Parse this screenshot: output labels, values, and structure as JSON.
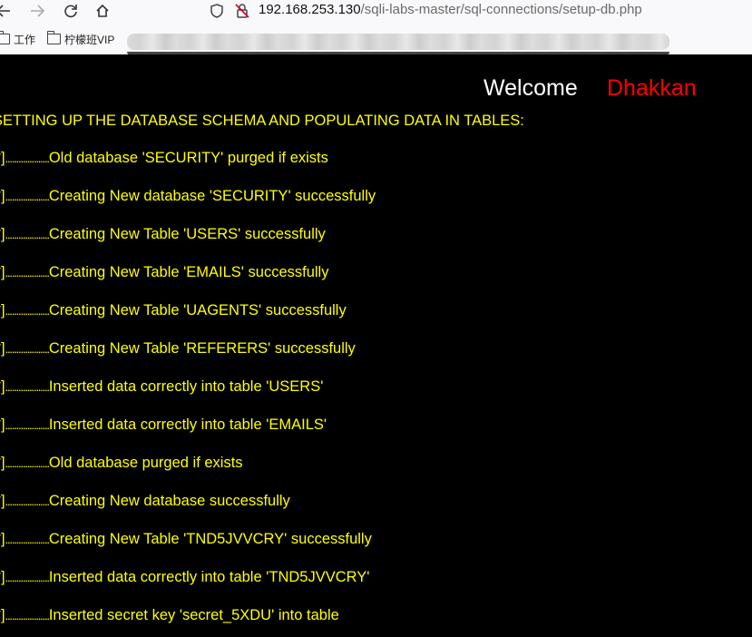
{
  "browser": {
    "back_icon": "arrow-left-icon",
    "forward_icon": "arrow-right-icon",
    "reload_icon": "reload-icon",
    "home_icon": "home-icon",
    "tracking_icon": "shield-icon",
    "insecure_icon": "lock-slash-icon",
    "url_host": "192.168.253.130",
    "url_path": "/sqli-labs-master/sql-connections/setup-db.php"
  },
  "bookmarks": [
    {
      "label": "工作",
      "icon": "folder-icon"
    },
    {
      "label": "柠檬班VIP",
      "icon": "folder-icon"
    }
  ],
  "page": {
    "welcome_word": "Welcome",
    "welcome_name": "Dhakkan",
    "heading": "SETTING UP THE DATABASE SCHEMA AND POPULATING DATA IN TABLES:",
    "log_prefix": "[*]",
    "log_dots": "....................",
    "log_lines": [
      "Old database 'SECURITY' purged if exists",
      "Creating New database 'SECURITY' successfully",
      "Creating New Table 'USERS' successfully",
      "Creating New Table 'EMAILS' successfully",
      "Creating New Table 'UAGENTS' successfully",
      "Creating New Table 'REFERERS' successfully",
      "Inserted data correctly into table 'USERS'",
      "Inserted data correctly into table 'EMAILS'",
      "Old database purged if exists",
      "Creating New database successfully",
      "Creating New Table 'TND5JVVCRY' successfully",
      "Inserted data correctly into table 'TND5JVVCRY'",
      "Inserted secret key 'secret_5XDU' into table"
    ],
    "colors": {
      "background": "#000000",
      "log_text": "#ffff00",
      "welcome_word": "#ffffff",
      "welcome_name": "#ff0000"
    }
  }
}
